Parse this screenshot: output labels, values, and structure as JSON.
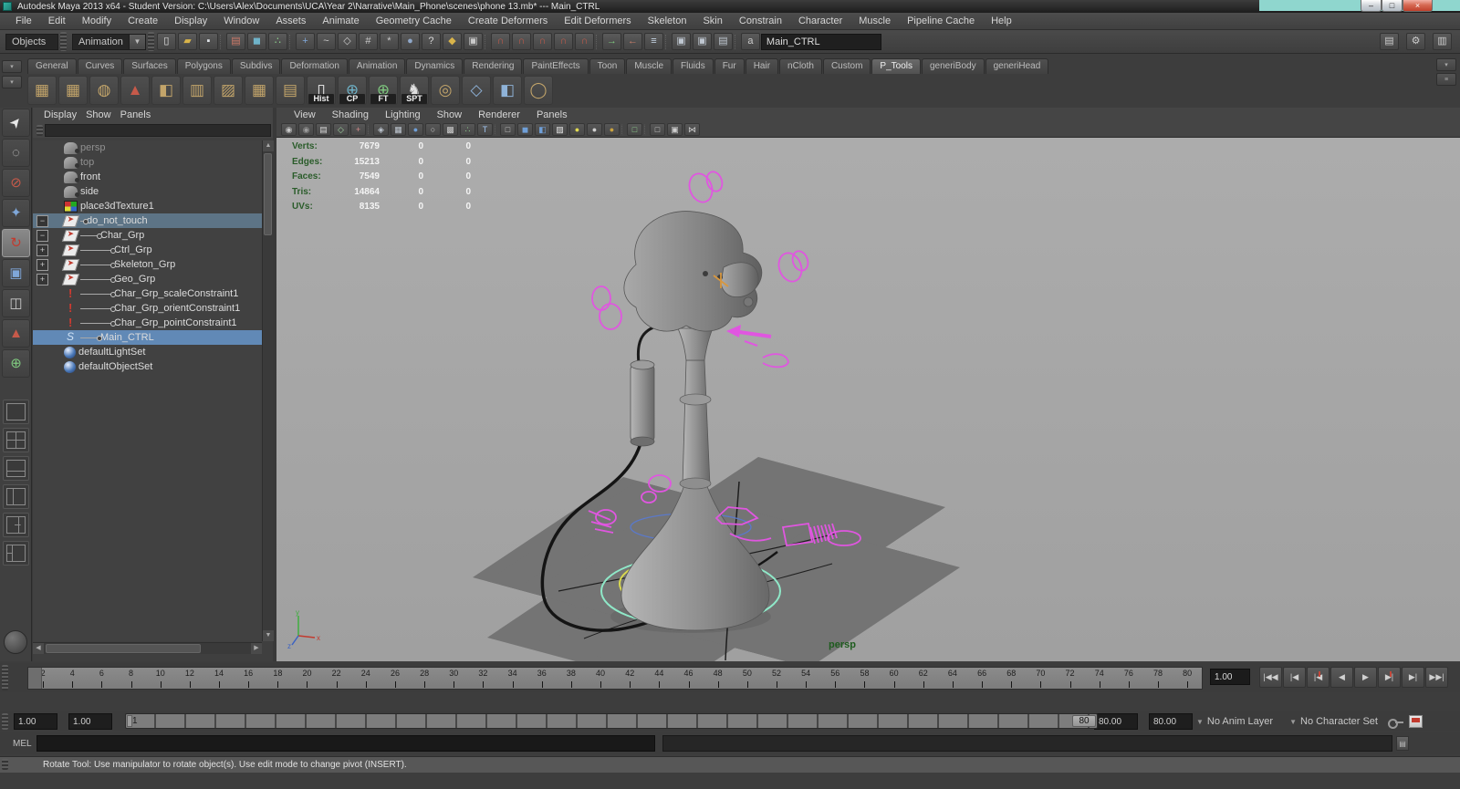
{
  "window": {
    "title": "Autodesk Maya 2013 x64 - Student Version: C:\\Users\\Alex\\Documents\\UCA\\Year 2\\Narrative\\Main_Phone\\scenes\\phone 13.mb*  ---  Main_CTRL",
    "controls": {
      "minimize": "–",
      "maximize": "□",
      "close": "×"
    }
  },
  "menubar": {
    "items": [
      "File",
      "Edit",
      "Modify",
      "Create",
      "Display",
      "Window",
      "Assets",
      "Animate",
      "Geometry Cache",
      "Create Deformers",
      "Edit Deformers",
      "Skeleton",
      "Skin",
      "Constrain",
      "Character",
      "Muscle",
      "Pipeline Cache",
      "Help"
    ]
  },
  "statusline": {
    "menuset_value": "Animation",
    "dropdown_arrow": "▼",
    "objects_filter": "Objects",
    "quick_select_value": "Main_CTRL",
    "icons": [
      {
        "name": "new-scene-icon",
        "glyph": "▯",
        "fg": "#e6e6e6"
      },
      {
        "name": "open-scene-icon",
        "glyph": "▰",
        "fg": "#d9b44a"
      },
      {
        "name": "save-scene-icon",
        "glyph": "▪",
        "fg": "#dfe3e8"
      },
      {
        "sep": true,
        "name": "separator"
      },
      {
        "name": "select-hierarchy-icon",
        "glyph": "▤",
        "fg": "#d07a6a"
      },
      {
        "name": "select-object-mode-icon",
        "glyph": "◼",
        "fg": "#6fb3c9",
        "active": true
      },
      {
        "name": "select-component-mode-icon",
        "glyph": "∴",
        "fg": "#8fd38f"
      },
      {
        "sep": true,
        "name": "separator"
      },
      {
        "name": "mask-points-icon",
        "glyph": "+",
        "fg": "#7fa7d9"
      },
      {
        "name": "mask-curves-icon",
        "glyph": "~",
        "fg": "#c9c9c9"
      },
      {
        "name": "mask-surfaces-icon",
        "glyph": "◇",
        "fg": "#c9c9c9"
      },
      {
        "name": "mask-deformations-icon",
        "glyph": "#",
        "fg": "#c9c9c9"
      },
      {
        "name": "mask-dynamics-icon",
        "glyph": "*",
        "fg": "#c9c9c9"
      },
      {
        "name": "mask-rendering-icon",
        "glyph": "●",
        "fg": "#8fa7c9"
      },
      {
        "name": "mask-misc-icon",
        "glyph": "?",
        "fg": "#d9d9d9"
      },
      {
        "name": "lock-selection-icon",
        "glyph": "◆",
        "fg": "#d9b44a"
      },
      {
        "name": "highlight-selection-icon",
        "glyph": "▣",
        "fg": "#c9c9c9"
      },
      {
        "sep": true,
        "name": "separator"
      },
      {
        "name": "snap-grid-icon",
        "glyph": "∩",
        "fg": "#c65a4a"
      },
      {
        "name": "snap-curve-icon",
        "glyph": "∩",
        "fg": "#c65a4a"
      },
      {
        "name": "snap-point-icon",
        "glyph": "∩",
        "fg": "#c65a4a"
      },
      {
        "name": "snap-plane-icon",
        "glyph": "∩",
        "fg": "#c65a4a"
      },
      {
        "name": "snap-live-icon",
        "glyph": "∩",
        "fg": "#c65a4a"
      },
      {
        "sep": true,
        "name": "separator"
      },
      {
        "name": "input-connections-icon",
        "glyph": "→",
        "fg": "#7fc97f"
      },
      {
        "name": "output-connections-icon",
        "glyph": "←",
        "fg": "#c97f6a"
      },
      {
        "name": "construction-history-icon",
        "glyph": "≡",
        "fg": "#c9d9e9"
      },
      {
        "sep": true,
        "name": "separator"
      },
      {
        "name": "render-current-frame-icon",
        "glyph": "▣",
        "fg": "#bfc7d1"
      },
      {
        "name": "ipr-render-icon",
        "glyph": "▣",
        "fg": "#bfc7d1"
      },
      {
        "name": "render-settings-icon",
        "glyph": "▤",
        "fg": "#bfc7d1"
      },
      {
        "sep": true,
        "name": "separator"
      },
      {
        "name": "quick-select-field-icon",
        "glyph": "a",
        "fg": "#c9c9c9"
      }
    ],
    "sidebar_toggles": [
      {
        "name": "attribute-editor-toggle",
        "glyph": "▤"
      },
      {
        "name": "tool-settings-toggle",
        "glyph": "⚙"
      },
      {
        "name": "channel-box-toggle",
        "glyph": "▥"
      }
    ]
  },
  "shelf": {
    "tabs": [
      {
        "label": "General"
      },
      {
        "label": "Curves"
      },
      {
        "label": "Surfaces"
      },
      {
        "label": "Polygons"
      },
      {
        "label": "Subdivs"
      },
      {
        "label": "Deformation"
      },
      {
        "label": "Animation"
      },
      {
        "label": "Dynamics"
      },
      {
        "label": "Rendering"
      },
      {
        "label": "PaintEffects"
      },
      {
        "label": "Toon"
      },
      {
        "label": "Muscle"
      },
      {
        "label": "Fluids"
      },
      {
        "label": "Fur"
      },
      {
        "label": "Hair"
      },
      {
        "label": "nCloth"
      },
      {
        "label": "Custom"
      },
      {
        "label": "P_Tools",
        "active": true
      },
      {
        "label": "generiBody"
      },
      {
        "label": "generiHead"
      }
    ],
    "items": [
      {
        "name": "poly-extrude-tool",
        "glyph": "▦",
        "fg": "#c2a46a",
        "badge": ""
      },
      {
        "name": "poly-extrude-edge-tool",
        "glyph": "▦",
        "fg": "#c2a46a",
        "badge": ""
      },
      {
        "name": "poly-cage-tool",
        "glyph": "◍",
        "fg": "#c2a46a",
        "badge": ""
      },
      {
        "name": "poly-spike-tool",
        "glyph": "▲",
        "fg": "#c65a4a",
        "badge": ""
      },
      {
        "name": "poly-cube-tool",
        "glyph": "◧",
        "fg": "#c2a46a",
        "badge": ""
      },
      {
        "name": "poly-split-tool",
        "glyph": "▥",
        "fg": "#c2a46a",
        "badge": ""
      },
      {
        "name": "poly-slice-tool",
        "glyph": "▨",
        "fg": "#c2a46a",
        "badge": ""
      },
      {
        "name": "poly-lattice-trash-tool",
        "glyph": "▦",
        "fg": "#c2a46a",
        "badge": ""
      },
      {
        "name": "poly-stack-tool",
        "glyph": "▤",
        "fg": "#c2a46a",
        "badge": ""
      },
      {
        "name": "history-tool",
        "glyph": "▯",
        "fg": "#f0f0f0",
        "badge": "Hist"
      },
      {
        "name": "center-pivot-tool",
        "glyph": "⊕",
        "fg": "#6fb3c9",
        "badge": "CP"
      },
      {
        "name": "freeze-transform-tool",
        "glyph": "⊕",
        "fg": "#7fc97f",
        "badge": "FT"
      },
      {
        "name": "spt-tool",
        "glyph": "♞",
        "fg": "#e0e0e0",
        "badge": "SPT"
      },
      {
        "name": "circle-cage-tool",
        "glyph": "◎",
        "fg": "#c2a46a",
        "badge": ""
      },
      {
        "name": "plane-tool",
        "glyph": "◇",
        "fg": "#8fb3d9",
        "badge": ""
      },
      {
        "name": "mirror-tool",
        "glyph": "◧",
        "fg": "#8fb3d9",
        "badge": ""
      },
      {
        "name": "wire-sphere-tool",
        "glyph": "◯",
        "fg": "#c2a46a",
        "badge": ""
      }
    ],
    "left_arrows": [
      "▾",
      "▾"
    ],
    "right_arrows": [
      "▾",
      "≡"
    ]
  },
  "toolbox": {
    "tools": [
      {
        "name": "select-tool",
        "glyph": "➤",
        "fg": "#e8e8e8"
      },
      {
        "name": "lasso-select-tool",
        "glyph": "◌",
        "fg": "#d0d0d0"
      },
      {
        "name": "paint-select-tool",
        "glyph": "⊘",
        "fg": "#c65a4a"
      },
      {
        "name": "move-tool",
        "glyph": "✦",
        "fg": "#7fa7d9"
      },
      {
        "name": "rotate-tool",
        "glyph": "↻",
        "fg": "#c23a2e",
        "active": true
      },
      {
        "name": "scale-tool",
        "glyph": "▣",
        "fg": "#7fa7d9"
      },
      {
        "name": "universal-manipulator-tool",
        "glyph": "◫",
        "fg": "#c9c9c9"
      },
      {
        "name": "soft-modification-tool",
        "glyph": "▲",
        "fg": "#c65a4a"
      },
      {
        "name": "show-manipulator-tool",
        "glyph": "⊕",
        "fg": "#7fc97f"
      }
    ]
  },
  "outliner": {
    "menus": [
      "Display",
      "Show",
      "Panels"
    ],
    "search_value": "",
    "items": [
      {
        "name": "outliner-item-persp",
        "label": "persp",
        "icon": "camera",
        "indent": 1,
        "state": "dim"
      },
      {
        "name": "outliner-item-top",
        "label": "top",
        "icon": "camera",
        "indent": 1,
        "state": "dim"
      },
      {
        "name": "outliner-item-front",
        "label": "front",
        "icon": "camera",
        "indent": 1
      },
      {
        "name": "outliner-item-side",
        "label": "side",
        "icon": "camera",
        "indent": 1
      },
      {
        "name": "outliner-item-place3dtexture1",
        "label": "place3dTexture1",
        "icon": "texture",
        "indent": 1
      },
      {
        "name": "outliner-item-do-not-touch",
        "label": "do_not_touch",
        "icon": "transform",
        "indent": 1,
        "state": "selected",
        "expander": "−",
        "twig": true
      },
      {
        "name": "outliner-item-char-grp",
        "label": "Char_Grp",
        "icon": "transform",
        "indent": 2,
        "expander": "−",
        "twig": true
      },
      {
        "name": "outliner-item-ctrl-grp",
        "label": "Ctrl_Grp",
        "icon": "transform",
        "indent": 3,
        "expander": "+",
        "twig": true
      },
      {
        "name": "outliner-item-skeleton-grp",
        "label": "Skeleton_Grp",
        "icon": "transform",
        "indent": 3,
        "expander": "+",
        "twig": true
      },
      {
        "name": "outliner-item-geo-grp",
        "label": "Geo_Grp",
        "icon": "transform",
        "indent": 3,
        "expander": "+",
        "twig": true
      },
      {
        "name": "outliner-item-char-grp-scaleconstraint1",
        "label": "Char_Grp_scaleConstraint1",
        "icon": "exclaim",
        "indent": 3,
        "twig": true
      },
      {
        "name": "outliner-item-char-grp-orientconstraint1",
        "label": "Char_Grp_orientConstraint1",
        "icon": "exclaim",
        "indent": 3,
        "twig": true
      },
      {
        "name": "outliner-item-char-grp-pointconstraint1",
        "label": "Char_Grp_pointConstraint1",
        "icon": "exclaim",
        "indent": 3,
        "twig": true
      },
      {
        "name": "outliner-item-main-ctrl",
        "label": "Main_CTRL",
        "icon": "curve",
        "indent": 2,
        "state": "selected2",
        "twig": true
      },
      {
        "name": "outliner-item-defaultlightset",
        "label": "defaultLightSet",
        "icon": "set",
        "indent": 1
      },
      {
        "name": "outliner-item-defaultobjectset",
        "label": "defaultObjectSet",
        "icon": "set",
        "indent": 1
      }
    ]
  },
  "viewport": {
    "menus": [
      "View",
      "Shading",
      "Lighting",
      "Show",
      "Renderer",
      "Panels"
    ],
    "toolbar_icons": [
      {
        "name": "select-camera-icon",
        "glyph": "◉",
        "fg": "#c9c9c9"
      },
      {
        "name": "camera-attributes-icon",
        "glyph": "◉",
        "fg": "#9a9a9a"
      },
      {
        "name": "bookmarks-icon",
        "glyph": "▤",
        "fg": "#d9d9d9"
      },
      {
        "name": "image-plane-icon",
        "glyph": "◇",
        "fg": "#9fd39f"
      },
      {
        "name": "view-compass-icon",
        "glyph": "+",
        "fg": "#d98c8c"
      },
      {
        "sep": true,
        "name": "separator"
      },
      {
        "name": "grease-pencil-icon",
        "glyph": "◈",
        "fg": "#bfc7d1"
      },
      {
        "name": "film-gate-icon",
        "glyph": "▦",
        "fg": "#bfc7d1"
      },
      {
        "name": "shaded-sphere-icon",
        "glyph": "●",
        "fg": "#6f9fd8"
      },
      {
        "name": "wireframe-sphere-icon",
        "glyph": "○",
        "fg": "#cfcfcf"
      },
      {
        "name": "xray-icon",
        "glyph": "▩",
        "fg": "#cfcfcf"
      },
      {
        "name": "vertex-display-icon",
        "glyph": "∴",
        "fg": "#8fd38f"
      },
      {
        "name": "texture-display-icon",
        "glyph": "T",
        "fg": "#9fc3ef"
      },
      {
        "sep": true,
        "name": "separator"
      },
      {
        "name": "wireframe-mode-icon",
        "glyph": "□",
        "fg": "#cfcfcf"
      },
      {
        "name": "smooth-shade-mode-icon",
        "glyph": "◼",
        "fg": "#6f9fd8"
      },
      {
        "name": "textured-mode-icon",
        "glyph": "◧",
        "fg": "#6f9fd8"
      },
      {
        "name": "use-all-lights-icon",
        "glyph": "▨",
        "fg": "#e8e8e8"
      },
      {
        "name": "ambient-light-icon",
        "glyph": "●",
        "fg": "#e0da52"
      },
      {
        "name": "flat-light-icon",
        "glyph": "●",
        "fg": "#cfcfcf"
      },
      {
        "name": "default-material-icon",
        "glyph": "●",
        "fg": "#c9a23f"
      },
      {
        "sep": true,
        "name": "separator"
      },
      {
        "name": "isolate-select-icon",
        "glyph": "□",
        "fg": "#8fd38f"
      },
      {
        "sep": true,
        "name": "separator"
      },
      {
        "name": "single-pane-icon",
        "glyph": "□",
        "fg": "#cfcfcf"
      },
      {
        "name": "multi-pane-icon",
        "glyph": "▣",
        "fg": "#cfcfcf"
      },
      {
        "name": "share-view-icon",
        "glyph": "⋈",
        "fg": "#cfcfcf"
      }
    ],
    "hud": {
      "rows": [
        {
          "label": "Verts:",
          "v1": "7679",
          "v2": "0",
          "v3": "0"
        },
        {
          "label": "Edges:",
          "v1": "15213",
          "v2": "0",
          "v3": "0"
        },
        {
          "label": "Faces:",
          "v1": "7549",
          "v2": "0",
          "v3": "0"
        },
        {
          "label": "Tris:",
          "v1": "14864",
          "v2": "0",
          "v3": "0"
        },
        {
          "label": "UVs:",
          "v1": "8135",
          "v2": "0",
          "v3": "0"
        }
      ]
    },
    "camera_label": "persp",
    "axis": {
      "x": "x",
      "y": "y",
      "z": "z"
    }
  },
  "timeline": {
    "tick_labels": [
      2,
      4,
      6,
      8,
      10,
      12,
      14,
      16,
      18,
      20,
      22,
      24,
      26,
      28,
      30,
      32,
      34,
      36,
      38,
      40,
      42,
      44,
      46,
      48,
      50,
      52,
      54,
      56,
      58,
      60,
      62,
      64,
      66,
      68,
      70,
      72,
      74,
      76,
      78,
      80
    ],
    "current_time_field": "1.00",
    "playback": [
      {
        "name": "go-to-start-button",
        "glyph": "|◀◀"
      },
      {
        "name": "step-back-frame-button",
        "glyph": "|◀"
      },
      {
        "name": "step-back-key-button",
        "glyph": "|◀",
        "accent": true
      },
      {
        "name": "play-backwards-button",
        "glyph": "◀"
      },
      {
        "name": "play-forwards-button",
        "glyph": "▶"
      },
      {
        "name": "step-forward-key-button",
        "glyph": "▶|",
        "accent": true
      },
      {
        "name": "step-forward-frame-button",
        "glyph": "▶|"
      },
      {
        "name": "go-to-end-button",
        "glyph": "▶▶|"
      }
    ]
  },
  "range": {
    "animation_start": "1.00",
    "playback_start": "1.00",
    "start_label": "1",
    "end_label": "80",
    "playback_end": "80.00",
    "animation_end": "80.00",
    "anim_layer": "No Anim Layer",
    "character_set": "No Character Set",
    "dropdown_arrow": "▼"
  },
  "command_line": {
    "label": "MEL",
    "value": ""
  },
  "help_line": {
    "text": "Rotate Tool: Use manipulator to rotate object(s). Use edit mode to change pivot (INSERT)."
  },
  "colors": {
    "viewport_bg": "#a7a7a7",
    "hud_green": "#2a5c2a",
    "selection_magenta": "#e056e0",
    "selected_row_blue": "#6189b6",
    "close_button_red": "#c0412c",
    "background_window_teal": "#8fd6ce"
  }
}
